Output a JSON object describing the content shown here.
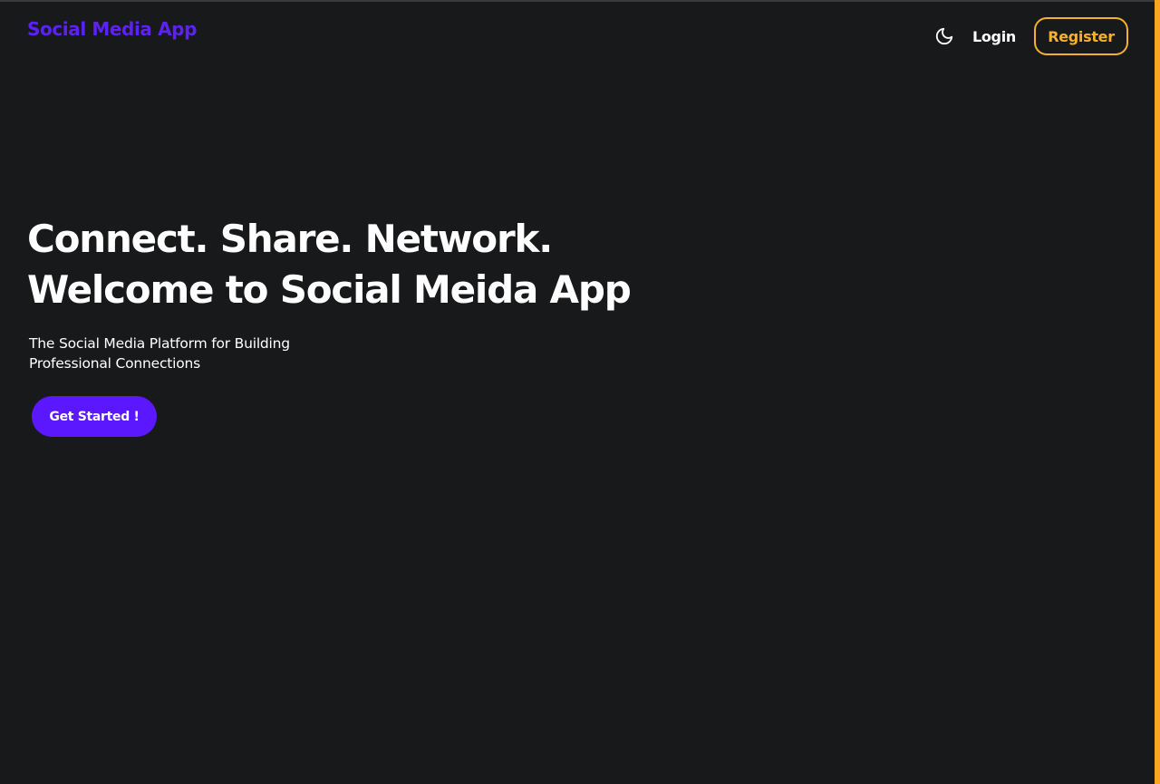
{
  "navbar": {
    "brand": "Social Media App",
    "theme_toggle_icon": "moon-icon",
    "login_label": "Login",
    "register_label": "Register"
  },
  "hero": {
    "title_line1": "Connect. Share. Network.",
    "title_line2": "Welcome to Social Meida App",
    "subtitle": "The Social Media Platform for Building Professional Connections",
    "cta_label": "Get Started !"
  },
  "colors": {
    "background": "#18191b",
    "brand": "#5b21f5",
    "accent": "#f5b030",
    "cta_background": "#5b18ff",
    "text": "#ffffff"
  }
}
